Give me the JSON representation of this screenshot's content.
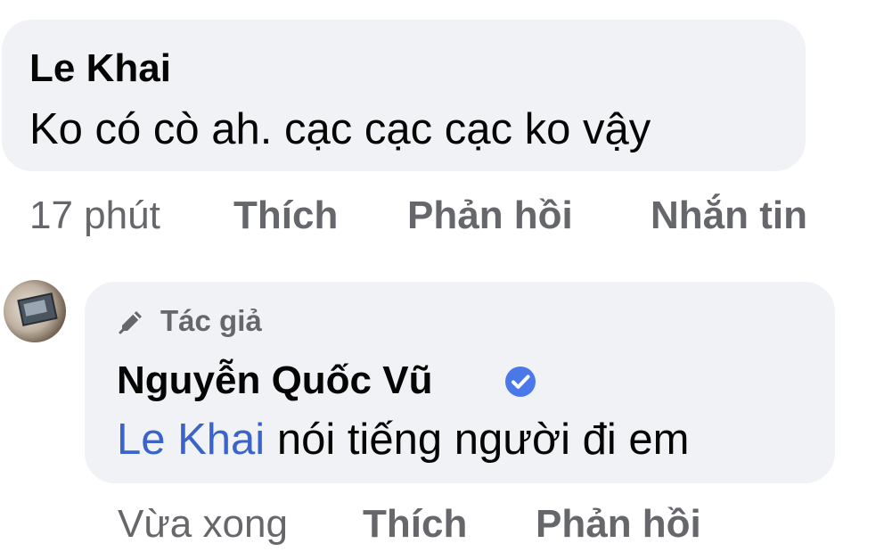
{
  "comment_1": {
    "author": "Le Khai",
    "text": "Ko có cò ah. cạc cạc cạc ko vậy",
    "actions": {
      "time": "17 phút",
      "like": "Thích",
      "reply": "Phản hồi",
      "message": "Nhắn tin"
    }
  },
  "comment_2": {
    "badge": "Tác giả",
    "author": "Nguyễn Quốc Vũ",
    "mention": "Le Khai",
    "text": " nói tiếng người đi em",
    "actions": {
      "time": "Vừa xong",
      "like": "Thích",
      "reply": "Phản hồi"
    }
  },
  "icons": {
    "badge_icon": "pencil-icon",
    "verified_icon": "verified-check-icon"
  },
  "colors": {
    "bubble": "#f0f2f5",
    "text": "#050505",
    "secondary": "#65676b",
    "mention": "#3a64c9",
    "verified": "#4a78e8"
  }
}
